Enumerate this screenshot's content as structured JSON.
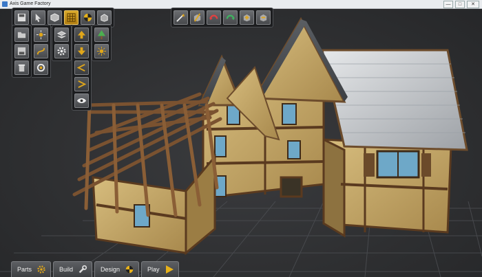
{
  "window": {
    "title": "Axis Game Factory",
    "minimize": "—",
    "maximize": "□",
    "close": "✕"
  },
  "colors": {
    "accent": "#e0a61a",
    "wood": "#6b4426",
    "plaster": "#b89a5c",
    "roof_slate": "#c8cbcf",
    "window_glass": "#6ea8c8"
  },
  "top_left_toolbar": [
    {
      "icon": "save-icon"
    },
    {
      "icon": "pointer-icon"
    },
    {
      "icon": "cube-icon"
    },
    {
      "icon": "grid-icon",
      "active": true
    },
    {
      "icon": "terrain-icon"
    },
    {
      "icon": "objects-icon"
    }
  ],
  "left_panel_col1": [
    {
      "icon": "folder-open-icon"
    },
    {
      "icon": "save-disk-icon"
    },
    {
      "icon": "trash-icon"
    }
  ],
  "left_panel_col2": [
    {
      "icon": "sun-tool-icon"
    },
    {
      "icon": "path-icon"
    },
    {
      "icon": "camera-icon"
    }
  ],
  "left_panel_col3": [
    {
      "icon": "layers-icon"
    },
    {
      "icon": "gear-icon"
    }
  ],
  "left_panel_col4": [
    {
      "icon": "arrow-up-icon"
    },
    {
      "icon": "arrow-down-icon"
    },
    {
      "icon": "chevron-left-icon"
    },
    {
      "icon": "chevron-right-icon"
    },
    {
      "icon": "eye-icon"
    }
  ],
  "left_panel_col5": [
    {
      "icon": "tree-icon"
    },
    {
      "icon": "light-icon"
    }
  ],
  "top_center_toolbar": [
    {
      "icon": "wand-icon"
    },
    {
      "icon": "magic-cube-icon"
    },
    {
      "icon": "undo-icon"
    },
    {
      "icon": "redo-icon"
    },
    {
      "icon": "add-cube-icon"
    },
    {
      "icon": "remove-cube-icon"
    }
  ],
  "bottom_tabs": [
    {
      "label": "Parts",
      "icon": "gear-icon"
    },
    {
      "label": "Build",
      "icon": "wrench-icon"
    },
    {
      "label": "Design",
      "icon": "palette-icon"
    },
    {
      "label": "Play",
      "icon": "play-icon"
    }
  ]
}
